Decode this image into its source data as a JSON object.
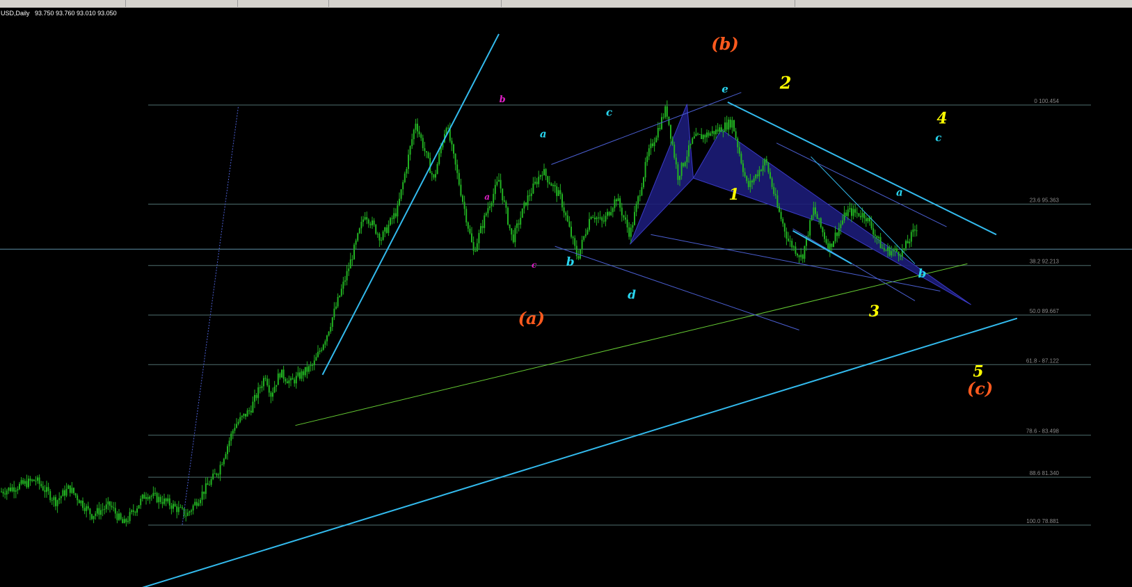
{
  "header": {
    "symbol": "USD,Daily",
    "ohlc": "93.750 93.760 93.010 93.050"
  },
  "colors": {
    "background": "#000000",
    "candles": "#22b322",
    "fib_lines": "#4f6f6f",
    "price_line": "#5f8fa8",
    "trendline_main": "#33bbee",
    "channel_lines": "#4b5fd2",
    "green_support": "#66cc33",
    "pattern_fill": "#1c1c78",
    "label_orange": "#ff5a1e",
    "label_yellow": "#ffff00",
    "label_cyan": "#29d6f0",
    "label_magenta": "#e020c8"
  },
  "fib_levels": [
    {
      "label": "0 100.454"
    },
    {
      "label": "23.6 95.363"
    },
    {
      "label": "38.2 92.213"
    },
    {
      "label": "50.0 89.667"
    },
    {
      "label": "61.8 - 87.122"
    },
    {
      "label": "78.6 - 83.498"
    },
    {
      "label": "88.6 81.340"
    },
    {
      "label": "100.0 78.881"
    }
  ],
  "wave_labels": [
    {
      "text": "(b)",
      "color": "orange"
    },
    {
      "text": "(a)",
      "color": "orange"
    },
    {
      "text": "(c)",
      "color": "orange"
    },
    {
      "text": "2",
      "color": "yellow"
    },
    {
      "text": "1",
      "color": "yellow"
    },
    {
      "text": "3",
      "color": "yellow"
    },
    {
      "text": "4",
      "color": "yellow"
    },
    {
      "text": "5",
      "color": "yellow"
    },
    {
      "text": "e",
      "color": "cyan"
    },
    {
      "text": "a",
      "color": "cyan"
    },
    {
      "text": "b",
      "color": "cyan"
    },
    {
      "text": "c",
      "color": "cyan"
    },
    {
      "text": "d",
      "color": "cyan"
    },
    {
      "text": "c",
      "color": "cyan"
    },
    {
      "text": "a",
      "color": "cyan"
    },
    {
      "text": "b",
      "color": "cyan"
    },
    {
      "text": "b",
      "color": "magenta"
    },
    {
      "text": "a",
      "color": "magenta"
    },
    {
      "text": "c",
      "color": "magenta"
    }
  ],
  "chart_data": {
    "type": "candlestick",
    "title": "USD,Daily",
    "last_bar": {
      "open": 93.75,
      "high": 93.76,
      "low": 93.01,
      "close": 93.05
    },
    "ylim": [
      74.5,
      104.0
    ],
    "fibonacci_retracement": [
      {
        "ratio": 0.0,
        "price": 100.454
      },
      {
        "ratio": 23.6,
        "price": 95.363
      },
      {
        "ratio": 38.2,
        "price": 92.213
      },
      {
        "ratio": 50.0,
        "price": 89.667
      },
      {
        "ratio": 61.8,
        "price": 87.122
      },
      {
        "ratio": 78.6,
        "price": 83.498
      },
      {
        "ratio": 88.6,
        "price": 81.34
      },
      {
        "ratio": 100.0,
        "price": 78.881
      }
    ],
    "swing_path": [
      {
        "bar": 0,
        "price": 80.6
      },
      {
        "bar": 38,
        "price": 81.2
      },
      {
        "bar": 60,
        "price": 80.1
      },
      {
        "bar": 75,
        "price": 80.8
      },
      {
        "bar": 100,
        "price": 79.4
      },
      {
        "bar": 120,
        "price": 79.9
      },
      {
        "bar": 135,
        "price": 78.9
      },
      {
        "bar": 160,
        "price": 80.5
      },
      {
        "bar": 185,
        "price": 80.0
      },
      {
        "bar": 205,
        "price": 79.4
      },
      {
        "bar": 240,
        "price": 81.7
      },
      {
        "bar": 258,
        "price": 84.0
      },
      {
        "bar": 275,
        "price": 84.8
      },
      {
        "bar": 292,
        "price": 86.6
      },
      {
        "bar": 298,
        "price": 85.6
      },
      {
        "bar": 308,
        "price": 86.7
      },
      {
        "bar": 320,
        "price": 86.2
      },
      {
        "bar": 345,
        "price": 87.1
      },
      {
        "bar": 360,
        "price": 88.7
      },
      {
        "bar": 382,
        "price": 91.8
      },
      {
        "bar": 402,
        "price": 94.9
      },
      {
        "bar": 420,
        "price": 93.6
      },
      {
        "bar": 438,
        "price": 95.1
      },
      {
        "bar": 458,
        "price": 99.6
      },
      {
        "bar": 478,
        "price": 96.6
      },
      {
        "bar": 492,
        "price": 99.5
      },
      {
        "bar": 508,
        "price": 96.0
      },
      {
        "bar": 522,
        "price": 92.9
      },
      {
        "bar": 538,
        "price": 95.2
      },
      {
        "bar": 550,
        "price": 96.6
      },
      {
        "bar": 565,
        "price": 93.5
      },
      {
        "bar": 580,
        "price": 95.5
      },
      {
        "bar": 598,
        "price": 97.1
      },
      {
        "bar": 618,
        "price": 95.7
      },
      {
        "bar": 637,
        "price": 92.6
      },
      {
        "bar": 652,
        "price": 94.9
      },
      {
        "bar": 665,
        "price": 94.4
      },
      {
        "bar": 680,
        "price": 95.7
      },
      {
        "bar": 695,
        "price": 93.8
      },
      {
        "bar": 715,
        "price": 97.9
      },
      {
        "bar": 735,
        "price": 100.3
      },
      {
        "bar": 748,
        "price": 96.8
      },
      {
        "bar": 765,
        "price": 98.7
      },
      {
        "bar": 790,
        "price": 99.1
      },
      {
        "bar": 808,
        "price": 99.6
      },
      {
        "bar": 825,
        "price": 96.2
      },
      {
        "bar": 845,
        "price": 97.6
      },
      {
        "bar": 858,
        "price": 95.2
      },
      {
        "bar": 870,
        "price": 93.5
      },
      {
        "bar": 885,
        "price": 92.6
      },
      {
        "bar": 898,
        "price": 95.1
      },
      {
        "bar": 915,
        "price": 93.1
      },
      {
        "bar": 935,
        "price": 95.0
      },
      {
        "bar": 955,
        "price": 94.8
      },
      {
        "bar": 975,
        "price": 93.0
      },
      {
        "bar": 996,
        "price": 92.9
      },
      {
        "bar": 1012,
        "price": 94.2
      }
    ]
  }
}
